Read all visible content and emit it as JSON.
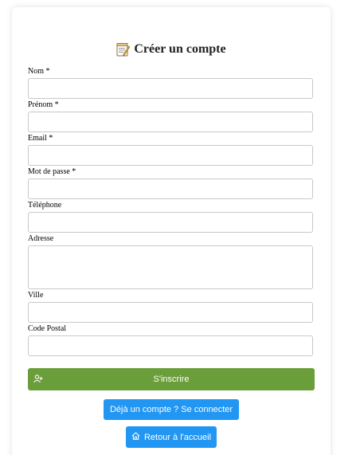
{
  "form": {
    "title": "Créer un compte",
    "title_icon": "memo-icon",
    "fields": {
      "nom": {
        "label": "Nom *",
        "value": "",
        "placeholder": ""
      },
      "prenom": {
        "label": "Prénom *",
        "value": "",
        "placeholder": ""
      },
      "email": {
        "label": "Email *",
        "value": "",
        "placeholder": ""
      },
      "password": {
        "label": "Mot de passe *",
        "value": "",
        "placeholder": ""
      },
      "telephone": {
        "label": "Téléphone",
        "value": "",
        "placeholder": ""
      },
      "adresse": {
        "label": "Adresse",
        "value": "",
        "placeholder": ""
      },
      "ville": {
        "label": "Ville",
        "value": "",
        "placeholder": ""
      },
      "code_postal": {
        "label": "Code Postal",
        "value": "",
        "placeholder": ""
      }
    },
    "submit_label": "S'inscrire",
    "submit_icon": "user-plus-icon",
    "login_label": "Déjà un compte ? Se connecter",
    "home_label": "Retour à l'accueil",
    "home_icon": "home-icon"
  },
  "colors": {
    "submit": "#6a9e3a",
    "secondary": "#2196f3",
    "input_border": "#c8c8c8"
  }
}
